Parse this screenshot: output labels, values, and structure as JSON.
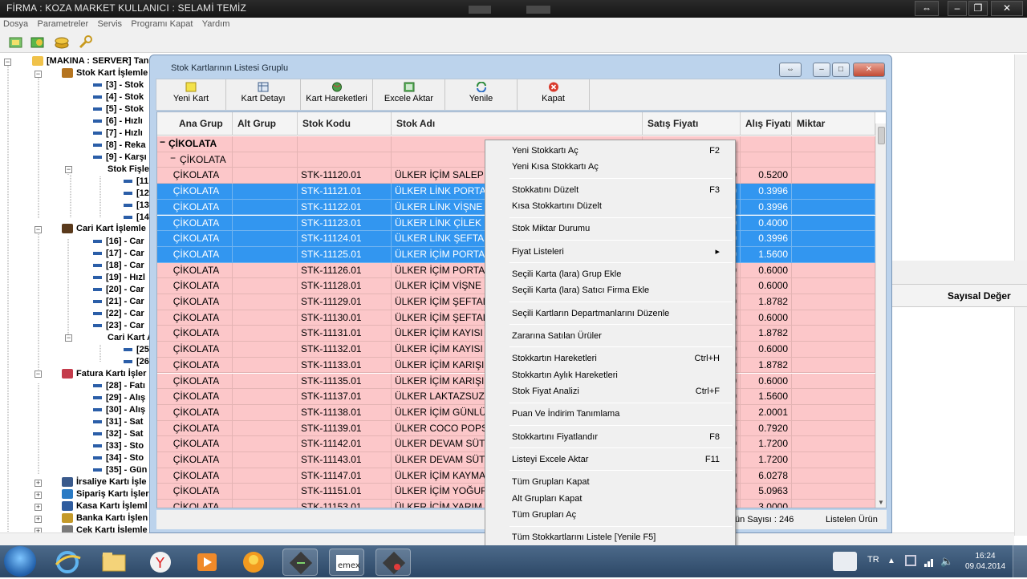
{
  "app": {
    "title": "FİRMA : KOZA MARKET    KULLANICI : SELAMİ TEMİZ"
  },
  "menu": [
    "Dosya",
    "Parametreler",
    "Servis",
    "Programı Kapat",
    "Yardım"
  ],
  "tree": {
    "root": "[MAKINA : SERVER] Tanı",
    "stok_group": "Stok Kart İşlemle",
    "stok_items": [
      "[3] - Stok",
      "[4] - Stok",
      "[5] - Stok",
      "[6] - Hızlı",
      "[7] - Hızlı",
      "[8] - Reka",
      "[9] - Karşı"
    ],
    "stok_fis": "Stok Fişle",
    "stok_fis_items": [
      "[11",
      "[12",
      "[13",
      "[14"
    ],
    "cari_group": "Cari Kart İşlemle",
    "cari_items": [
      "[16] - Car",
      "[17] - Car",
      "[18] - Car",
      "[19] - Hızl",
      "[20] - Car",
      "[21] - Car",
      "[22] - Car",
      "[23] - Car"
    ],
    "cari_sub": "Cari Kart A",
    "cari_sub_items": [
      "[25",
      "[26"
    ],
    "fatura_group": "Fatura Kartı İşler",
    "fatura_items": [
      "[28] - Fatı",
      "[29] - Alış",
      "[30] - Alış",
      "[31] - Sat",
      "[32] - Sat",
      "[33] - Sto",
      "[34] - Sto",
      "[35] - Gün"
    ],
    "other_groups": [
      "İrsaliye Kartı İşle",
      "Sipariş Kartı İşler",
      "Kasa Kartı İşleml",
      "Banka Kartı İşlen",
      "Çek Kartı İşlemle"
    ]
  },
  "background": {
    "sayisal": "Sayısal Değer"
  },
  "window": {
    "title": "Stok Kartlarının Listesi Gruplu",
    "toolbar": [
      "Yeni Kart",
      "Kart Detayı",
      "Kart Hareketleri",
      "Excele Aktar",
      "Yenile",
      "Kapat"
    ],
    "columns": [
      "Ana Grup",
      "Alt Grup",
      "Stok Kodu",
      "Stok Adı",
      "Satış Fiyatı",
      "Alış Fiyatı",
      "Miktar"
    ],
    "group_label": "ÇİKOLATA",
    "subgroup_label": "ÇİKOLATA",
    "rows": [
      {
        "ana": "ÇİKOLATA",
        "kod": "STK-11120.01",
        "ad": "ÜLKER İÇİM SALEP 1 K",
        "sat": "0",
        "alis": "0.5200",
        "sel": false
      },
      {
        "ana": "ÇİKOLATA",
        "kod": "STK-11121.01",
        "ad": "ÜLKER LİNK PORTAKA",
        "sat": "0",
        "alis": "0.3996",
        "sel": true
      },
      {
        "ana": "ÇİKOLATA",
        "kod": "STK-11122.01",
        "ad": "ÜLKER LİNK VİŞNE 25",
        "sat": "0",
        "alis": "0.3996",
        "sel": true
      },
      {
        "ana": "ÇİKOLATA",
        "kod": "STK-11123.01",
        "ad": "ÜLKER LİNK ÇİLEK 250",
        "sat": "0",
        "alis": "0.4000",
        "sel": true
      },
      {
        "ana": "ÇİKOLATA",
        "kod": "STK-11124.01",
        "ad": "ÜLKER LİNK ŞEFTALİ 2",
        "sat": "0",
        "alis": "0.3996",
        "sel": true
      },
      {
        "ana": "ÇİKOLATA",
        "kod": "STK-11125.01",
        "ad": "ÜLKER İÇİM PORTAKA",
        "sat": "0",
        "alis": "1.5600",
        "sel": true
      },
      {
        "ana": "ÇİKOLATA",
        "kod": "STK-11126.01",
        "ad": "ÜLKER İÇİM PORTAKA",
        "sat": "0",
        "alis": "0.6000",
        "sel": false
      },
      {
        "ana": "ÇİKOLATA",
        "kod": "STK-11128.01",
        "ad": "ÜLKER İÇİM VİŞNE 200",
        "sat": "0",
        "alis": "0.6000",
        "sel": false
      },
      {
        "ana": "ÇİKOLATA",
        "kod": "STK-11129.01",
        "ad": "ÜLKER İÇİM ŞEFTALİ 1",
        "sat": "0",
        "alis": "1.8782",
        "sel": false
      },
      {
        "ana": "ÇİKOLATA",
        "kod": "STK-11130.01",
        "ad": "ÜLKER İÇİM ŞEFTALİ 2",
        "sat": "0",
        "alis": "0.6000",
        "sel": false
      },
      {
        "ana": "ÇİKOLATA",
        "kod": "STK-11131.01",
        "ad": "ÜLKER İÇİM KAYISI 1 L",
        "sat": "0",
        "alis": "1.8782",
        "sel": false
      },
      {
        "ana": "ÇİKOLATA",
        "kod": "STK-11132.01",
        "ad": "ÜLKER İÇİM KAYISI 20",
        "sat": "0",
        "alis": "0.6000",
        "sel": false
      },
      {
        "ana": "ÇİKOLATA",
        "kod": "STK-11133.01",
        "ad": "ÜLKER İÇİM KARIŞIK 1",
        "sat": "0",
        "alis": "1.8782",
        "sel": false
      },
      {
        "ana": "ÇİKOLATA",
        "kod": "STK-11135.01",
        "ad": "ÜLKER İÇİM KARIŞIK 2",
        "sat": "0",
        "alis": "0.6000",
        "sel": false
      },
      {
        "ana": "ÇİKOLATA",
        "kod": "STK-11137.01",
        "ad": "ÜLKER LAKTAZSUZ SÜ",
        "sat": "0",
        "alis": "1.5600",
        "sel": false
      },
      {
        "ana": "ÇİKOLATA",
        "kod": "STK-11138.01",
        "ad": "ÜLKER İÇİM GÜNLÜK S",
        "sat": "0",
        "alis": "2.0001",
        "sel": false
      },
      {
        "ana": "ÇİKOLATA",
        "kod": "STK-11139.01",
        "ad": "ÜLKER COCO POPS ÇİI",
        "sat": "0",
        "alis": "0.7920",
        "sel": false
      },
      {
        "ana": "ÇİKOLATA",
        "kod": "STK-11142.01",
        "ad": "ÜLKER DEVAM SÜTÜ 5",
        "sat": "0",
        "alis": "1.7200",
        "sel": false
      },
      {
        "ana": "ÇİKOLATA",
        "kod": "STK-11143.01",
        "ad": "ÜLKER DEVAM SÜTÜ 5",
        "sat": "0",
        "alis": "1.7200",
        "sel": false
      },
      {
        "ana": "ÇİKOLATA",
        "kod": "STK-11147.01",
        "ad": "ÜLKER İÇİM KAYMAKLI",
        "sat": "0",
        "alis": "6.0278",
        "sel": false
      },
      {
        "ana": "ÇİKOLATA",
        "kod": "STK-11151.01",
        "ad": "ÜLKER İÇİM YOĞURT 2",
        "sat": "0",
        "alis": "5.0963",
        "sel": false
      },
      {
        "ana": "ÇİKOLATA",
        "kod": "STK-11153.01",
        "ad": "ÜLKER İÇİM YARIM YA",
        "sat": "0",
        "alis": "3.0000",
        "sel": false
      }
    ],
    "status_left": "ün Sayısı : 246",
    "status_right": "Listelen Ürün"
  },
  "context_menu": [
    {
      "label": "Yeni Stokkartı Aç",
      "shortcut": "F2"
    },
    {
      "label": "Yeni Kısa Stokkartı Aç",
      "shortcut": ""
    },
    {
      "sep": true
    },
    {
      "label": "Stokkatını Düzelt",
      "shortcut": "F3"
    },
    {
      "label": "Kısa Stokkartını Düzelt",
      "shortcut": ""
    },
    {
      "sep": true
    },
    {
      "label": "Stok Miktar Durumu",
      "shortcut": ""
    },
    {
      "sep": true
    },
    {
      "label": "Fiyat Listeleri",
      "shortcut": "▸"
    },
    {
      "sep": true
    },
    {
      "label": "Seçili Karta (lara) Grup Ekle",
      "shortcut": ""
    },
    {
      "label": "Seçili Karta (lara) Satıcı Firma Ekle",
      "shortcut": ""
    },
    {
      "sep": true
    },
    {
      "label": "Seçili Kartların Departmanlarını Düzenle",
      "shortcut": ""
    },
    {
      "sep": true
    },
    {
      "label": "Zararına Satılan Ürüler",
      "shortcut": ""
    },
    {
      "sep": true
    },
    {
      "label": "Stokkartın Hareketleri",
      "shortcut": "Ctrl+H"
    },
    {
      "label": "Stokkartın Aylık Hareketleri",
      "shortcut": ""
    },
    {
      "label": "Stok Fiyat Analizi",
      "shortcut": "Ctrl+F"
    },
    {
      "sep": true
    },
    {
      "label": "Puan Ve İndirim Tanımlama",
      "shortcut": ""
    },
    {
      "sep": true
    },
    {
      "label": "Stokkartını Fiyatlandır",
      "shortcut": "F8"
    },
    {
      "sep": true
    },
    {
      "label": "Listeyi Excele Aktar",
      "shortcut": "F11"
    },
    {
      "sep": true
    },
    {
      "label": "Tüm Grupları Kapat",
      "shortcut": ""
    },
    {
      "label": "Alt Grupları Kapat",
      "shortcut": ""
    },
    {
      "label": "Tüm Grupları Aç",
      "shortcut": ""
    },
    {
      "sep": true
    },
    {
      "label": "Tüm Stokkartlarını Listele [Yenile F5]",
      "shortcut": ""
    }
  ],
  "taskbar": {
    "lang": "TR",
    "time": "16:24",
    "date": "09.04.2014",
    "apps": [
      "start-orb",
      "ie-icon",
      "explorer-icon",
      "yandex-icon",
      "media-player-icon",
      "orange-app-icon",
      "excel-app-icon",
      "emex-icon",
      "app-icon"
    ]
  }
}
